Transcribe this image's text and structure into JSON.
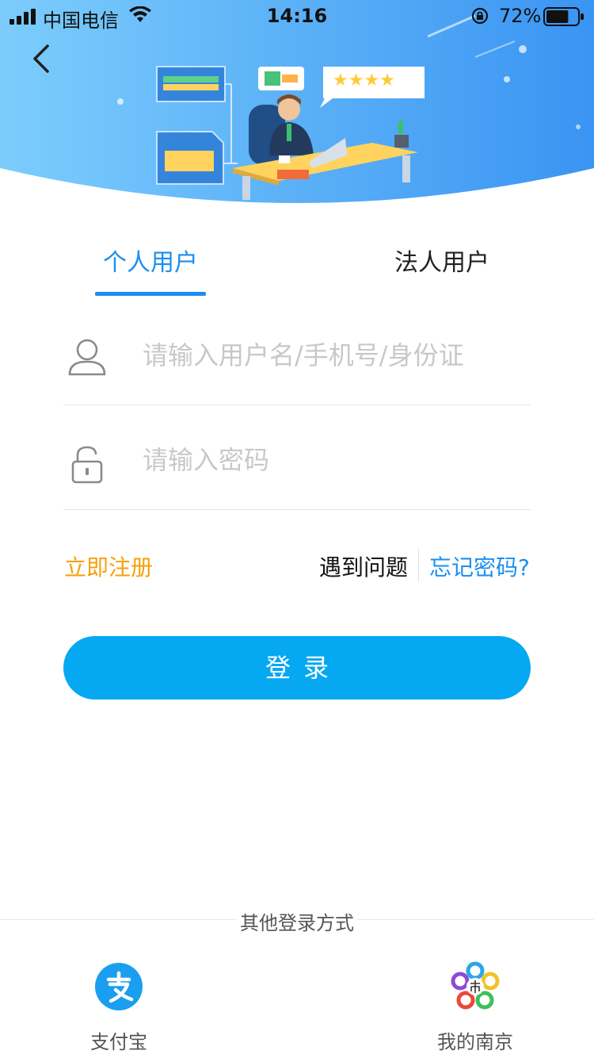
{
  "status_bar": {
    "carrier": "中国电信",
    "time": "14:16",
    "battery_percent": "72%",
    "battery_level": 0.72,
    "icons": [
      "signal-icon",
      "wifi-icon",
      "rotation-lock-icon",
      "battery-icon"
    ]
  },
  "header": {
    "back_icon": "chevron-left-icon",
    "gradient_colors": [
      "#6ec8fb",
      "#3a96f2"
    ]
  },
  "tabs": [
    {
      "label": "个人用户",
      "active": true
    },
    {
      "label": "法人用户",
      "active": false
    }
  ],
  "form": {
    "username": {
      "value": "",
      "placeholder": "请输入用户名/手机号/身份证",
      "icon": "user-icon"
    },
    "password": {
      "value": "",
      "placeholder": "请输入密码",
      "icon": "lock-icon"
    }
  },
  "links": {
    "register": "立即注册",
    "problem": "遇到问题",
    "forgot": "忘记密码?"
  },
  "login_button": {
    "label": "登录"
  },
  "other_login": {
    "title": "其他登录方式",
    "options": [
      {
        "label": "支付宝",
        "icon": "alipay-icon"
      },
      {
        "label": "我的南京",
        "icon": "my-nanjing-icon"
      }
    ]
  },
  "colors": {
    "accent": "#1a8ff0",
    "button": "#07a8f2",
    "register_link": "#f5a20a",
    "alipay": "#1a9ff0"
  }
}
